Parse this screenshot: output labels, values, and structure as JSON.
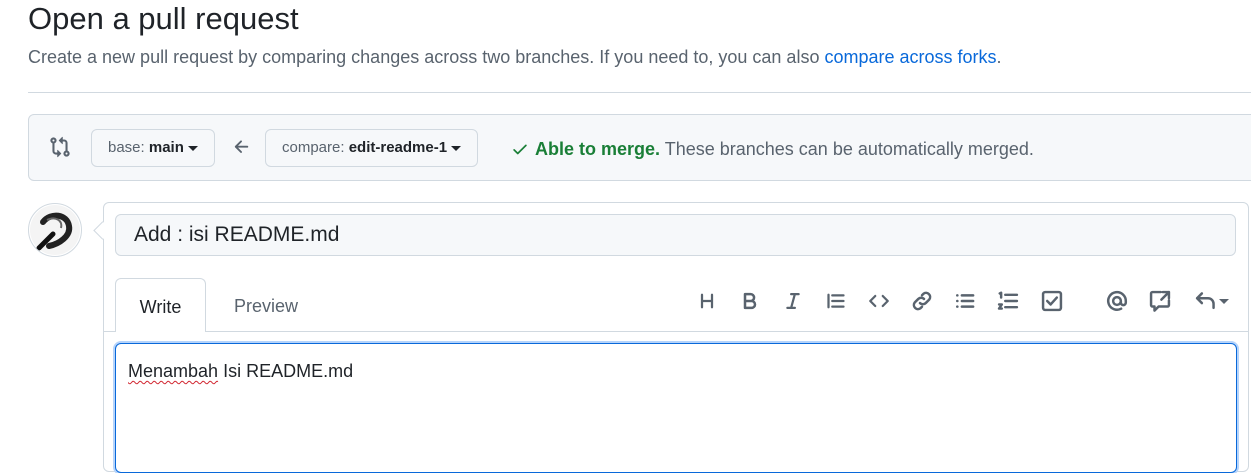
{
  "header": {
    "title": "Open a pull request",
    "subtitle": "Create a new pull request by comparing changes across two branches. If you need to, you can also",
    "subtitle_link": "compare across forks",
    "subtitle_end": "."
  },
  "range": {
    "base_prefix": "base:",
    "base_branch": "main",
    "compare_prefix": "compare:",
    "compare_branch": "edit-readme-1",
    "merge_ok": "Able to merge.",
    "merge_detail": "These branches can be automatically merged."
  },
  "form": {
    "title_value": "Add : isi README.md",
    "tabs": {
      "write": "Write",
      "preview": "Preview"
    },
    "toolbar": [
      "heading-icon",
      "bold-icon",
      "italic-icon",
      "quote-icon",
      "code-icon",
      "link-icon",
      "unordered-list-icon",
      "ordered-list-icon",
      "task-list-icon",
      "mention-icon",
      "reference-icon",
      "undo-icon"
    ],
    "body_word1": "Menambah",
    "body_rest": " Isi README.md"
  },
  "colors": {
    "accent": "#0969da",
    "success": "#1a7f37"
  }
}
